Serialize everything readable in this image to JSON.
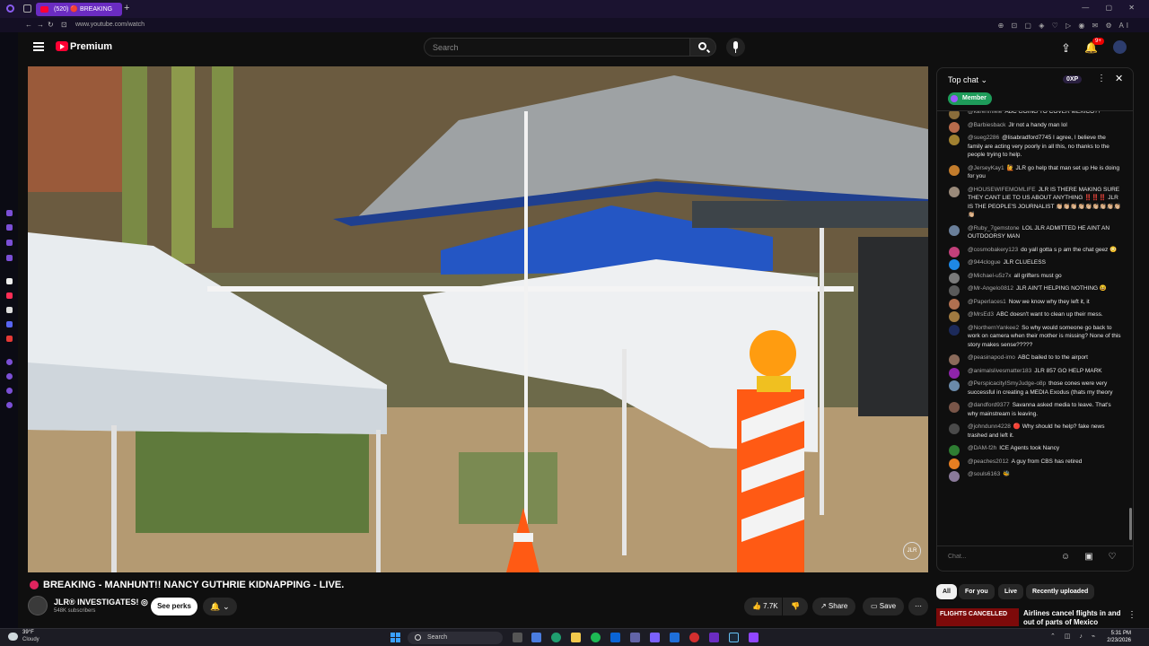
{
  "browser": {
    "tab_title": "(520) 🔴 BREAKING",
    "new_tab_label": "+",
    "url": "www.youtube.com/watch",
    "window_controls": "—  ▢  ✕",
    "extension_icons": "⊕ ⊡ ▢ ◈ ♡ ▷ ◉ ✉ ⚙ AI"
  },
  "header": {
    "logo_text": "Premium",
    "search_placeholder": "Search",
    "notification_count": "9+"
  },
  "video": {
    "title": "BREAKING - MANHUNT!! NANCY GUTHRIE KIDNAPPING - LIVE.",
    "watermark": "JLR"
  },
  "channel": {
    "name": "JLR® INVESTIGATES! ◎",
    "subscribers": "548K subscribers",
    "perks_label": "See perks",
    "bell_label": "🔔 ⌄"
  },
  "actions": {
    "likes": "👍 7.7K",
    "dislike": "👎",
    "share": "↗ Share",
    "save": "▭ Save",
    "more": "⋯"
  },
  "chat": {
    "mode": "Top chat ⌄",
    "xp": "0XP",
    "more": "⋮",
    "close": "✕",
    "member_chip": "Member",
    "input_placeholder": "Chat...",
    "messages": [
      {
        "author": "@karenmieie",
        "text": "ABC GOING TO COVER MEXICO??",
        "color": "#8a6d3b"
      },
      {
        "author": "@Barbiesback",
        "text": "Jlr not a handy man lol",
        "color": "#b86b4b"
      },
      {
        "author": "@sueg2286",
        "text": "@lisabradford7745 I agree, I believe the family are acting very poorly in all this, no thanks to the people trying to help.",
        "color": "#a08030"
      },
      {
        "author": "@JerseyKay1",
        "text": "🙋 JLR go help that man set up He is doing for you",
        "color": "#c27c2c"
      },
      {
        "author": "@HOUSEWIFEMOMLIFE",
        "text": "JLR IS THERE MAKING SURE THEY CANT LIE TO US ABOUT ANYTHING ‼️‼️‼️ JLR IS THE PEOPLE'S JOURNALIST 👏🏼👏🏼👏🏼👏🏼👏🏼👏🏼👏🏼👏🏼👏🏼👏🏼",
        "color": "#9a8a7a"
      },
      {
        "author": "@Ruby_7gemstone",
        "text": "LOL JLR ADMITTED HE AINT AN OUTDOORSY MAN",
        "color": "#6a7f9a"
      },
      {
        "author": "@cosmobakery123",
        "text": "do yall gotta s p am the chat geez 😳",
        "color": "#c2407a"
      },
      {
        "author": "@944clogue",
        "text": "JLR CLUELESS",
        "color": "#1e88e5"
      },
      {
        "author": "@Michael-u5z7x",
        "text": "all grifters must go",
        "color": "#7a7a7a"
      },
      {
        "author": "@Mr-Angelo0812",
        "text": "JLR AIN'T HELPING NOTHING 😆",
        "color": "#5a5a5a"
      },
      {
        "author": "@Paperlaces1",
        "text": "Now we know why they left it, it",
        "color": "#b07050"
      },
      {
        "author": "@MrsEd3",
        "text": "ABC doesn't want to clean up their mess.",
        "color": "#a07a40"
      },
      {
        "author": "@NorthernYankee2",
        "text": "So why would someone go back to work on camera when their mother is missing? None of this story makes sense?????",
        "color": "#1c2a5a"
      },
      {
        "author": "@peasinapod-imo",
        "text": "ABC bailed to to the airport",
        "color": "#8a6a5a"
      },
      {
        "author": "@animalslivesmatter183",
        "text": "JLR 857 GO HELP MARK",
        "color": "#8e24aa"
      },
      {
        "author": "@PerspicacityISmyJudge-o8p",
        "text": "those cones were very successful in creating a MEDIA Exodus (thats my theory",
        "color": "#6a8aaa"
      },
      {
        "author": "@dandford9377",
        "text": "Savanna asked media to leave. That's why mainstream is leaving.",
        "color": "#795548"
      },
      {
        "author": "@johndunn4228",
        "text": "🔴 Why should he help? fake news trashed and left it.",
        "color": "#4a4a4a"
      },
      {
        "author": "@DAM-f2h",
        "text": "ICE Agents took Nancy",
        "color": "#2e7d32"
      },
      {
        "author": "@peaches2012",
        "text": "A guy from CBS has retired",
        "color": "#e67e22"
      },
      {
        "author": "@souls6163",
        "text": "🐝",
        "color": "#8a7a9a"
      }
    ]
  },
  "filters": [
    "All",
    "For you",
    "Live",
    "Recently uploaded"
  ],
  "recommendation": {
    "thumb_label": "FLIGHTS CANCELLED",
    "title": "Airlines cancel flights in and out of parts of Mexico",
    "more": "⋮"
  },
  "taskbar": {
    "temperature": "39°F",
    "condition": "Cloudy",
    "search_label": "Search",
    "time": "5:31 PM",
    "date": "2/23/2026",
    "tray": "⌃ ◫ ♪ ⌁"
  }
}
